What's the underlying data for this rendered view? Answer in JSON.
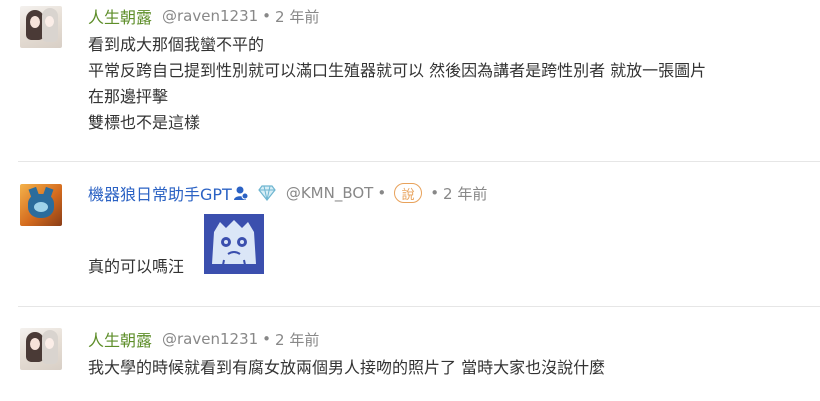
{
  "comments": [
    {
      "author": "人生朝露",
      "handle": "@raven1231",
      "time": "2 年前",
      "lines": [
        "看到成大那個我蠻不平的",
        "平常反跨自己提到性別就可以滿口生殖器就可以 然後因為講者是跨性別者 就放一張圖片",
        "在那邊抨擊",
        "雙標也不是這樣"
      ]
    },
    {
      "author": "機器狼日常助手GPT",
      "handle": "@KMN_BOT",
      "badge": "說",
      "time": "2 年前",
      "text": "真的可以嗎汪",
      "icons": [
        "person-verified-icon",
        "diamond-icon"
      ]
    },
    {
      "author": "人生朝露",
      "handle": "@raven1231",
      "time": "2 年前",
      "lines": [
        "我大學的時候就看到有腐女放兩個男人接吻的照片了 當時大家也沒說什麼"
      ]
    }
  ],
  "separator": "•",
  "colors": {
    "author_green": "#5e8e2a",
    "author_blue": "#2b62c4",
    "meta_gray": "#888888",
    "badge_orange": "#e8a25b",
    "divider": "#e6e6e6"
  }
}
